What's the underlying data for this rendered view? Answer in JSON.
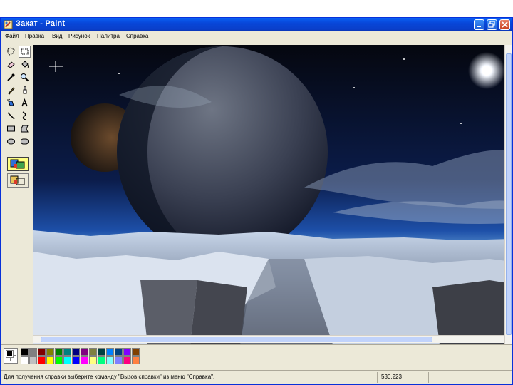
{
  "window": {
    "title": "Закат - Paint"
  },
  "menu": {
    "items": [
      "Файл",
      "Правка",
      "Вид",
      "Рисунок",
      "Палитра",
      "Справка"
    ]
  },
  "toolbox": {
    "tools": [
      {
        "name": "free-select-icon",
        "selected": false
      },
      {
        "name": "rect-select-icon",
        "selected": true
      },
      {
        "name": "eraser-icon",
        "selected": false
      },
      {
        "name": "fill-icon",
        "selected": false
      },
      {
        "name": "color-picker-icon",
        "selected": false
      },
      {
        "name": "magnifier-icon",
        "selected": false
      },
      {
        "name": "pencil-icon",
        "selected": false
      },
      {
        "name": "brush-icon",
        "selected": false
      },
      {
        "name": "airbrush-icon",
        "selected": false
      },
      {
        "name": "text-icon",
        "selected": false
      },
      {
        "name": "line-icon",
        "selected": false
      },
      {
        "name": "curve-icon",
        "selected": false
      },
      {
        "name": "rectangle-icon",
        "selected": false
      },
      {
        "name": "polygon-icon",
        "selected": false
      },
      {
        "name": "ellipse-icon",
        "selected": false
      },
      {
        "name": "rounded-rect-icon",
        "selected": false
      }
    ]
  },
  "palette": {
    "foreground": "#000000",
    "background": "#ffffff",
    "top_row": [
      "#000000",
      "#808080",
      "#800000",
      "#808000",
      "#008000",
      "#008080",
      "#000080",
      "#800080",
      "#808040",
      "#004040",
      "#0080ff",
      "#004080",
      "#8000ff",
      "#804000"
    ],
    "bottom_row": [
      "#ffffff",
      "#c0c0c0",
      "#ff0000",
      "#ffff00",
      "#00ff00",
      "#00ffff",
      "#0000ff",
      "#ff00ff",
      "#ffff80",
      "#00ff80",
      "#80ffff",
      "#8080ff",
      "#ff0080",
      "#ff8040"
    ]
  },
  "status": {
    "hint": "Для получения справки выберите команду \"Вызов справки\" из меню \"Справка\".",
    "coords": "530,223"
  }
}
